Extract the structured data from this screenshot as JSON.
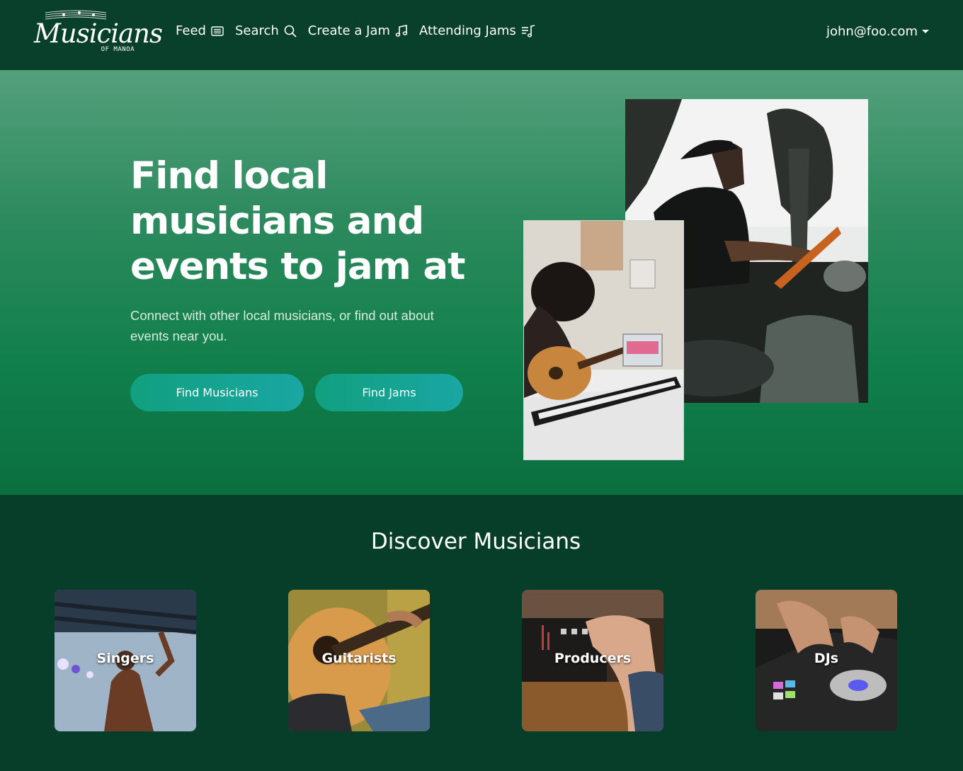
{
  "brand": {
    "name": "Musicians",
    "sub": "OF MANOA"
  },
  "nav": {
    "links": [
      {
        "label": "Feed",
        "icon": "newspaper-icon"
      },
      {
        "label": "Search",
        "icon": "search-icon"
      },
      {
        "label": "Create a Jam",
        "icon": "music-note-icon"
      },
      {
        "label": "Attending Jams",
        "icon": "music-list-icon"
      }
    ],
    "user_email": "john@foo.com"
  },
  "hero": {
    "title": "Find local musicians and events to jam at",
    "lead": "Connect with other local musicians, or find out about events near you.",
    "buttons": {
      "find_musicians": "Find Musicians",
      "find_jams": "Find Jams"
    }
  },
  "discover": {
    "title": "Discover Musicians",
    "categories": [
      {
        "label": "Singers"
      },
      {
        "label": "Guitarists"
      },
      {
        "label": "Producers"
      },
      {
        "label": "DJs"
      }
    ]
  },
  "colors": {
    "navbar": "#08402b",
    "hero_top": "#53a07c",
    "hero_bottom": "#0b6e3f",
    "button_start": "#11a07f",
    "button_end": "#1aa6a3",
    "section_bg": "#063e2a"
  }
}
